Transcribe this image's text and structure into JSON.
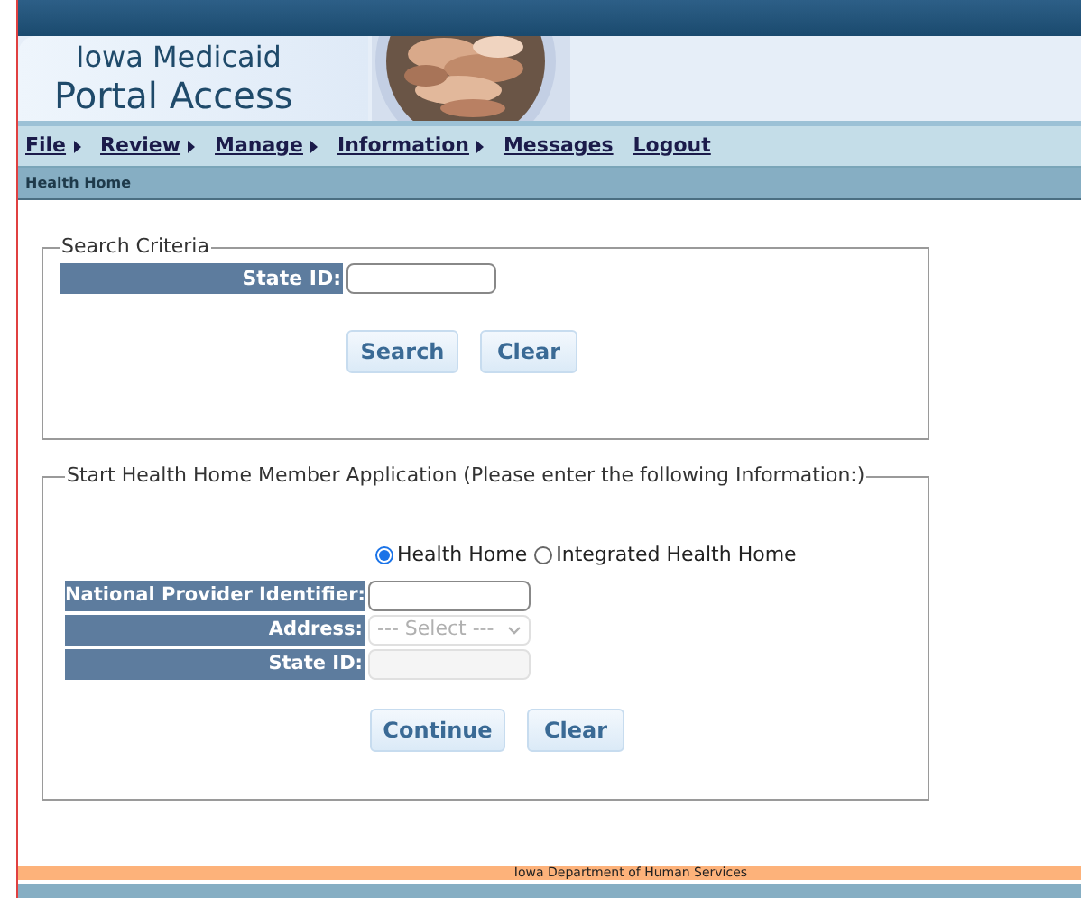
{
  "banner": {
    "title_line1": "Iowa Medicaid",
    "title_line2": "Portal Access",
    "kind": "picture"
  },
  "menu": [
    {
      "label": "File",
      "has_submenu": true
    },
    {
      "label": "Review",
      "has_submenu": true
    },
    {
      "label": "Manage",
      "has_submenu": true
    },
    {
      "label": "Information",
      "has_submenu": true
    },
    {
      "label": "Messages",
      "has_submenu": false
    },
    {
      "label": "Logout",
      "has_submenu": false
    }
  ],
  "breadcrumb": "Health Home",
  "search_criteria": {
    "legend": "Search Criteria",
    "fields": [
      {
        "label": "State ID:",
        "kind": "text",
        "disabled": false
      }
    ],
    "buttons": [
      "Search",
      "Clear"
    ]
  },
  "application": {
    "legend": "Start Health Home Member Application (Please enter the following Information:)",
    "options": [
      {
        "label": "Health Home",
        "selected": true
      },
      {
        "label": "Integrated Health Home",
        "selected": false
      }
    ],
    "fields": [
      {
        "label": "National Provider Identifier:",
        "kind": "text",
        "disabled": false
      },
      {
        "label": "Address:",
        "kind": "select",
        "value": "--- Select ---",
        "disabled": true
      },
      {
        "label": "State ID:",
        "kind": "text",
        "disabled": true
      }
    ],
    "buttons": [
      "Continue",
      "Clear"
    ]
  },
  "footer": "Iowa Department of Human Services"
}
